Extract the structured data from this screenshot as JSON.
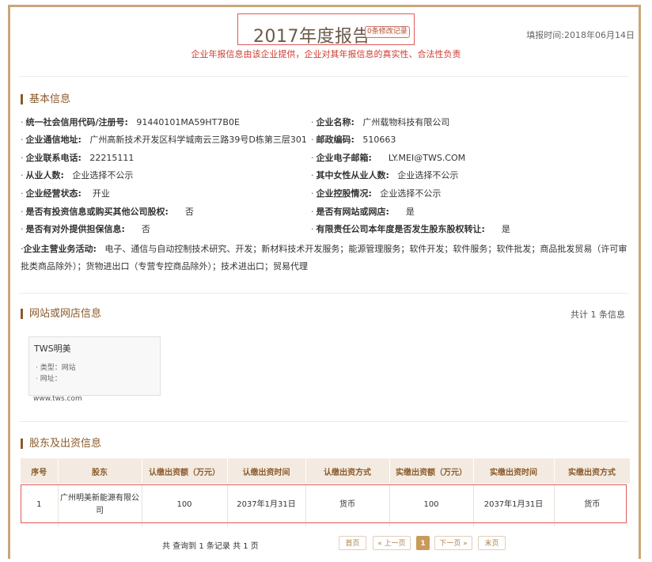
{
  "header": {
    "title": "2017年度报告",
    "modify_badge": "0条修改记录",
    "report_time": "填报时间:2018年06月14日",
    "disclaimer": "企业年报信息由该企业提供，企业对其年报信息的真实性、合法性负责"
  },
  "basic": {
    "section_title": "基本信息",
    "rows": [
      {
        "label": "统一社会信用代码/注册号:",
        "value": "91440101MA59HT7B0E"
      },
      {
        "label": "企业名称:",
        "value": "广州载物科技有限公司"
      },
      {
        "label": "企业通信地址:",
        "value": "广州高新技术开发区科学城南云三路39号D栋第三层301"
      },
      {
        "label": "邮政编码:",
        "value": "510663"
      },
      {
        "label": "企业联系电话:",
        "value": "22215111"
      },
      {
        "label": "企业电子邮箱:",
        "value": "LY.MEI@TWS.COM"
      },
      {
        "label": "从业人数:",
        "value": "企业选择不公示"
      },
      {
        "label": "其中女性从业人数:",
        "value": "企业选择不公示"
      },
      {
        "label": "企业经营状态:",
        "value": "开业"
      },
      {
        "label": "企业控股情况:",
        "value": "企业选择不公示"
      },
      {
        "label": "是否有投资信息或购买其他公司股权:",
        "value": "否"
      },
      {
        "label": "是否有网站或网店:",
        "value": "是"
      },
      {
        "label": "是否有对外提供担保信息:",
        "value": "否"
      },
      {
        "label": "有限责任公司本年度是否发生股东股权转让:",
        "value": "是"
      }
    ],
    "scope_label": "企业主营业务活动:",
    "scope_value": "电子、通信与自动控制技术研究、开发；新材料技术开发服务；能源管理服务；软件开发；软件服务；软件批发；商品批发贸易（许可审批类商品除外）；货物进出口（专营专控商品除外）；技术进出口；贸易代理"
  },
  "website": {
    "section_title": "网站或网店信息",
    "count": "共计 1 条信息",
    "card": {
      "name": "TWS明美",
      "type_line": "· 类型：网站",
      "url_label": "· 网址：",
      "url": "www.tws.com"
    }
  },
  "shareholders": {
    "section_title": "股东及出资信息",
    "columns": [
      "序号",
      "股东",
      "认缴出资额（万元）",
      "认缴出资时间",
      "认缴出资方式",
      "实缴出资额（万元）",
      "实缴出资时间",
      "实缴出资方式"
    ],
    "rows": [
      [
        "1",
        "广州明美新能源有限公司",
        "100",
        "2037年1月31日",
        "货币",
        "100",
        "2037年1月31日",
        "货币"
      ]
    ]
  },
  "pager": {
    "info": "共 查询到 1 条记录 共 1 页",
    "first": "首页",
    "prev": "« 上一页",
    "current": "1",
    "next": "下一页 »",
    "last": "末页"
  },
  "colors": {
    "accent": "#8b5a2b",
    "frame": "#c9a77a",
    "highlight": "#e05a5a",
    "disclaimer": "#d03b30"
  }
}
